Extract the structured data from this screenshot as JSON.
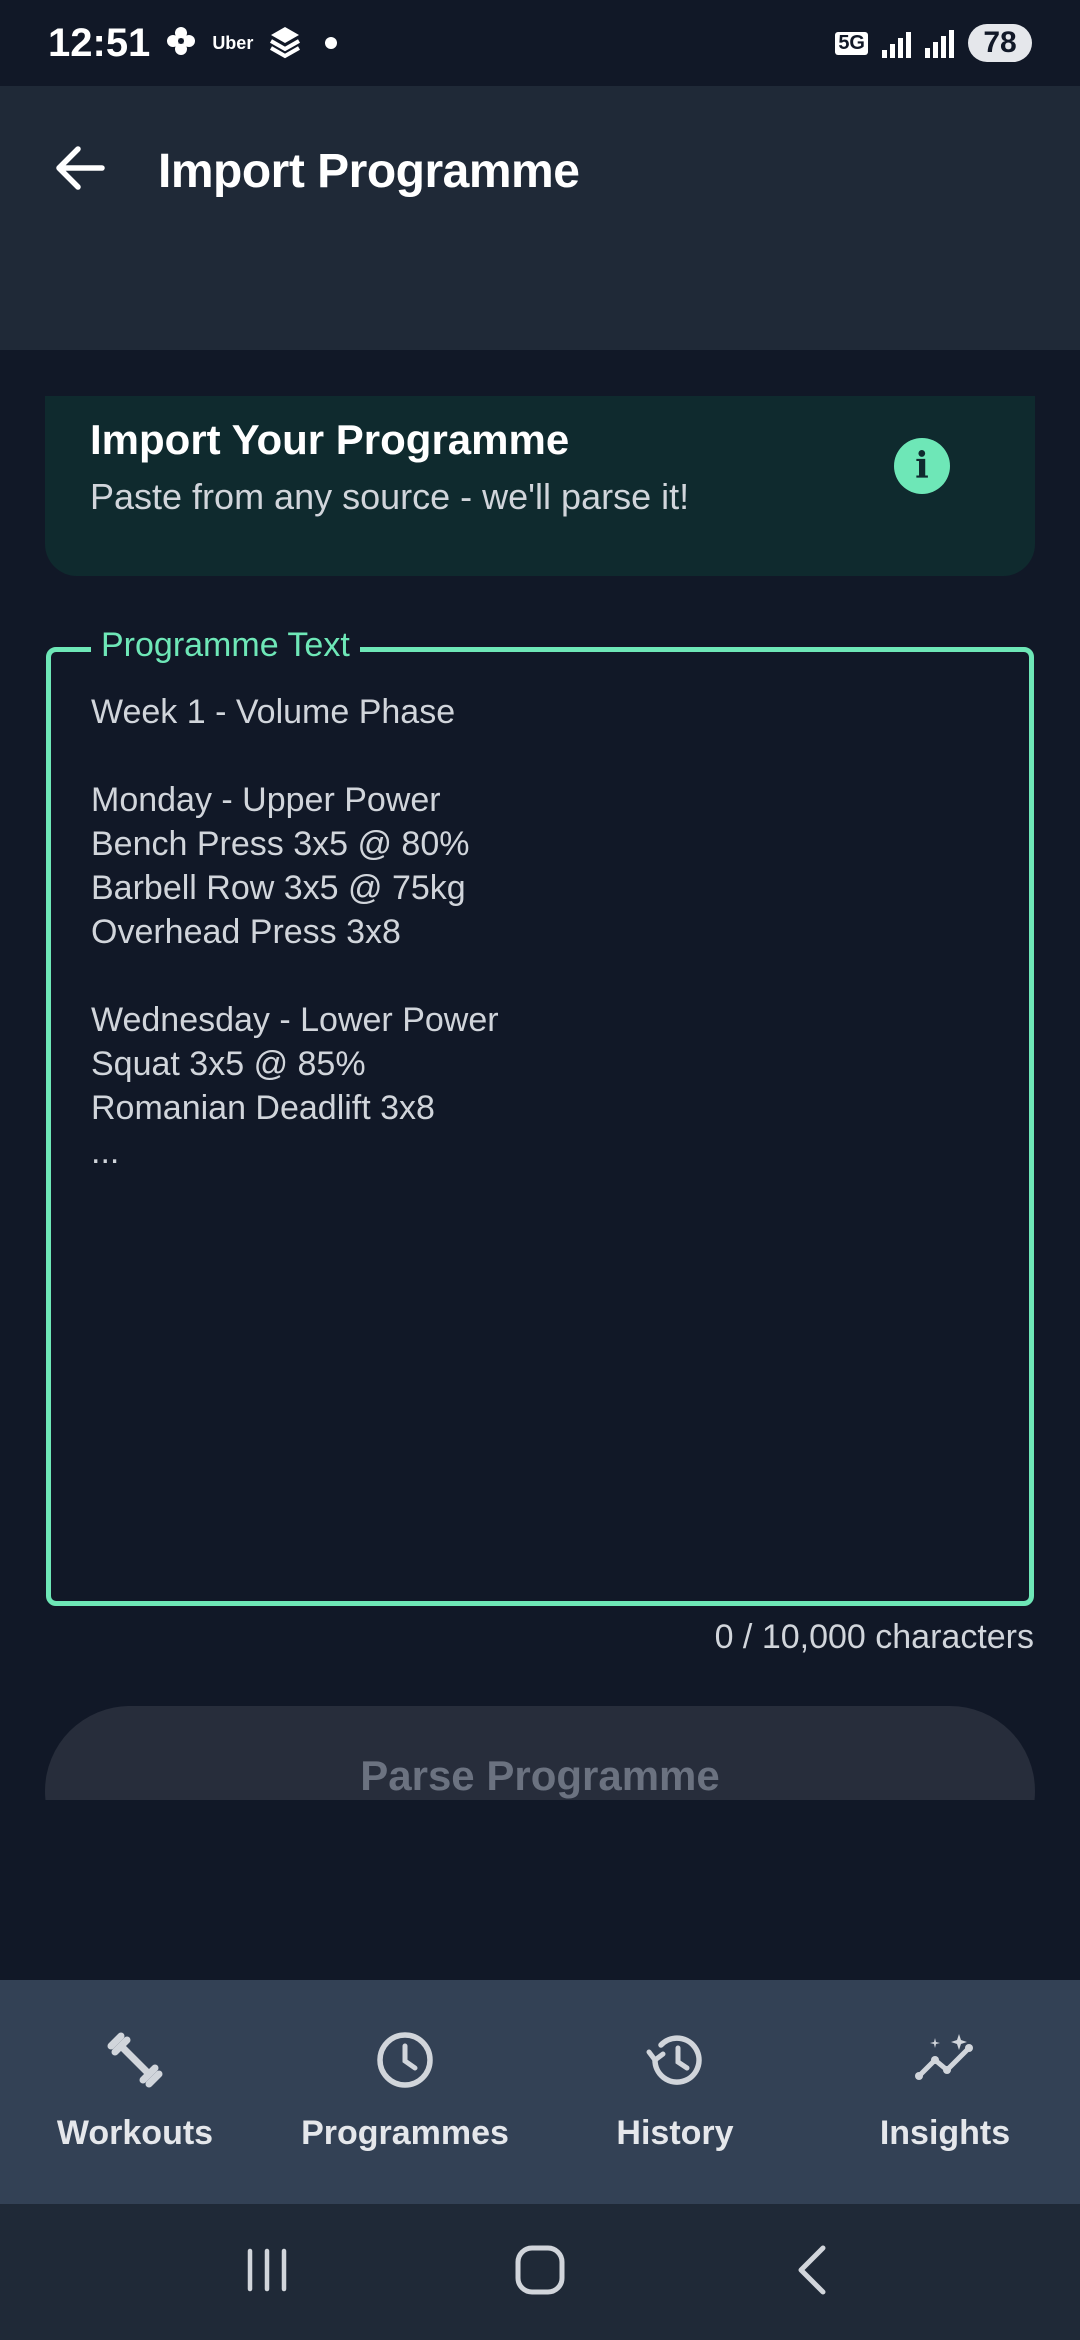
{
  "status_bar": {
    "time": "12:51",
    "app_label": "Uber",
    "network": "5G",
    "battery": "78"
  },
  "app_bar": {
    "title": "Import Programme",
    "back_icon": "arrow-back-icon"
  },
  "info_card": {
    "title": "Import Your Programme",
    "subtitle": "Paste from any source - we'll parse it!",
    "icon": "info-icon",
    "accent": "#6ee7b7"
  },
  "programme_field": {
    "label": "Programme Text",
    "placeholder": "Week 1 - Volume Phase\n\nMonday - Upper Power\nBench Press 3x5 @ 80%\nBarbell Row 3x5 @ 75kg\nOverhead Press 3x8\n\nWednesday - Lower Power\nSquat 3x5 @ 85%\nRomanian Deadlift 3x8\n...",
    "value": "",
    "char_count": "0 / 10,000 characters"
  },
  "parse_button": {
    "label": "Parse Programme",
    "enabled": false
  },
  "bottom_nav": {
    "items": [
      {
        "label": "Workouts",
        "icon": "dumbbell-icon"
      },
      {
        "label": "Programmes",
        "icon": "clock-icon"
      },
      {
        "label": "History",
        "icon": "history-icon"
      },
      {
        "label": "Insights",
        "icon": "insights-icon"
      }
    ]
  },
  "system_nav": {
    "recents_icon": "recents-icon",
    "home_icon": "home-icon",
    "back_icon": "back-chevron-icon"
  }
}
